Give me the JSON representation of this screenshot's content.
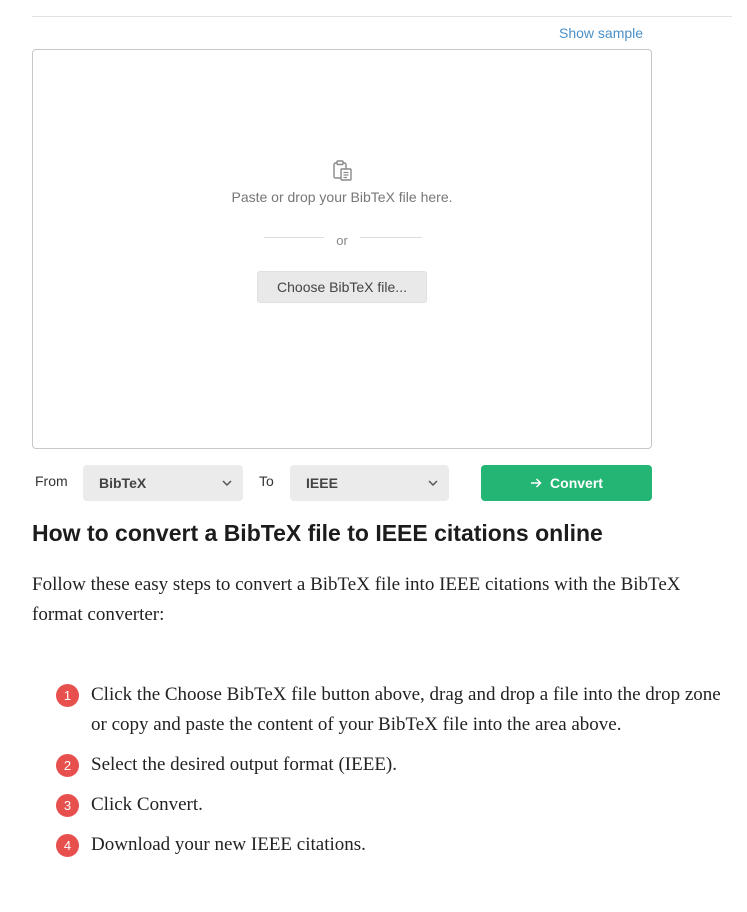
{
  "links": {
    "show_sample": "Show sample"
  },
  "dropzone": {
    "icon": "clipboard-icon",
    "prompt": "Paste or drop your BibTeX file here.",
    "or": "or",
    "choose_button": "Choose BibTeX file..."
  },
  "converter": {
    "from_label": "From",
    "from_value": "BibTeX",
    "to_label": "To",
    "to_value": "IEEE",
    "convert_label": "Convert",
    "convert_color": "#22b573"
  },
  "article": {
    "heading": "How to convert a BibTeX file to IEEE citations online",
    "intro": "Follow these easy steps to convert a BibTeX file into IEEE citations with the BibTeX format converter:",
    "steps": [
      {
        "num": "1",
        "text": "Click the Choose BibTeX file button above, drag and drop a file into the drop zone or copy and paste the content of your BibTeX file into the area above."
      },
      {
        "num": "2",
        "text": "Select the desired output format (IEEE)."
      },
      {
        "num": "3",
        "text": "Click Convert."
      },
      {
        "num": "4",
        "text": "Download your new IEEE citations."
      }
    ],
    "badge_color": "#e8504e"
  }
}
